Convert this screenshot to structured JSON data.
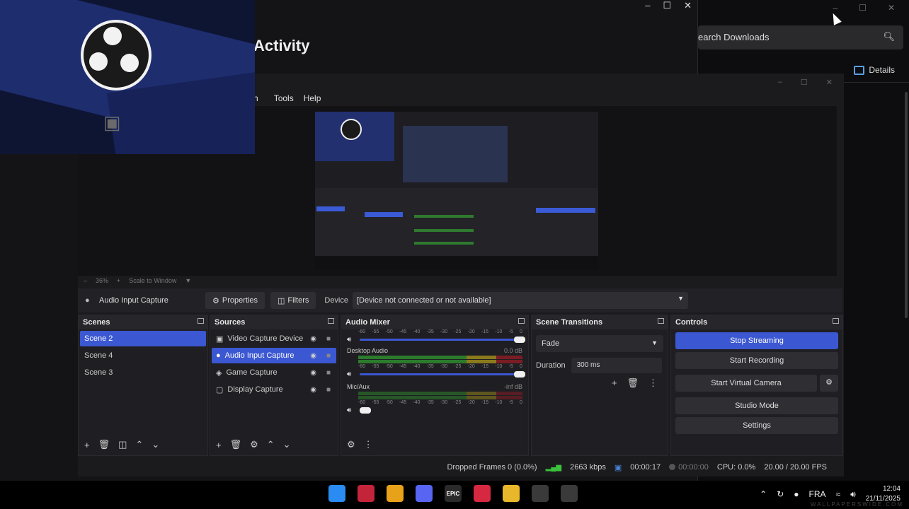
{
  "background_window": {
    "title": "Activity",
    "controls": [
      "–",
      "☐",
      "✕"
    ]
  },
  "downloads": {
    "search_placeholder": "earch Downloads",
    "details_label": "Details",
    "controls": [
      "–",
      "☐",
      "✕"
    ]
  },
  "obs": {
    "menu": [
      "n",
      "Tools",
      "Help"
    ],
    "zoom": {
      "level": "36%",
      "scale_mode": "Scale to Window"
    },
    "toolbar": {
      "source_name": "Audio Input Capture",
      "properties_label": "Properties",
      "filters_label": "Filters",
      "device_label": "Device",
      "device_value": "[Device not connected or not available]"
    },
    "scenes": {
      "title": "Scenes",
      "items": [
        "Scene 2",
        "Scene 4",
        "Scene 3"
      ],
      "selected": "Scene 2"
    },
    "sources": {
      "title": "Sources",
      "items": [
        {
          "label": "Video Capture Device",
          "icon": "camera-icon"
        },
        {
          "label": "Audio Input Capture",
          "icon": "microphone-icon"
        },
        {
          "label": "Game Capture",
          "icon": "gamepad-icon"
        },
        {
          "label": "Display Capture",
          "icon": "monitor-icon"
        }
      ],
      "selected": "Audio Input Capture"
    },
    "audio_mixer": {
      "title": "Audio Mixer",
      "scale": [
        "-60",
        "-55",
        "-50",
        "-45",
        "-40",
        "-35",
        "-30",
        "-25",
        "-20",
        "-15",
        "-10",
        "-5",
        "0"
      ],
      "channels": [
        {
          "name": "Desktop Audio",
          "db": "0.0 dB",
          "level": 1.0
        },
        {
          "name": "Mic/Aux",
          "db": "-inf dB",
          "level": 0.0
        }
      ]
    },
    "scene_transitions": {
      "title": "Scene Transitions",
      "transition": "Fade",
      "duration_label": "Duration",
      "duration_value": "300 ms"
    },
    "controls": {
      "title": "Controls",
      "stop_streaming": "Stop Streaming",
      "start_recording": "Start Recording",
      "start_virtual_camera": "Start Virtual Camera",
      "studio_mode": "Studio Mode",
      "settings": "Settings"
    },
    "status": {
      "dropped_frames": "Dropped Frames 0 (0.0%)",
      "bitrate": "2663 kbps",
      "stream_time": "00:00:17",
      "rec_time": "00:00:00",
      "cpu": "CPU: 0.0%",
      "fps": "20.00 / 20.00 FPS"
    }
  },
  "taskbar": {
    "apps": [
      {
        "name": "windows-start-icon",
        "color": "#2a8bf2"
      },
      {
        "name": "app-red-icon",
        "color": "#c4243a"
      },
      {
        "name": "chrome-icon",
        "color": "#e8a21a"
      },
      {
        "name": "discord-icon",
        "color": "#5865f2"
      },
      {
        "name": "epic-games-icon",
        "color": "#2a2a2a",
        "text": "EPIC"
      },
      {
        "name": "app-red-2-icon",
        "color": "#d62840"
      },
      {
        "name": "file-explorer-icon",
        "color": "#e8b82a"
      },
      {
        "name": "obs-icon",
        "color": "#3a3a3a"
      },
      {
        "name": "obs-live-icon",
        "color": "#3a3a3a"
      }
    ],
    "language": "FRA",
    "time": "12:04",
    "date": "21/11/2025",
    "watermark": "WALLPAPERSWIDE.COM"
  }
}
